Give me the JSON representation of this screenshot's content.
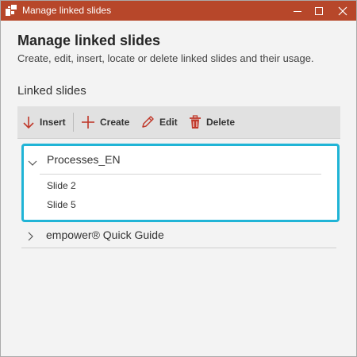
{
  "window": {
    "title": "Manage linked slides",
    "app_icon": "linked-slides-app-icon",
    "titlebar_color": "#b7472a"
  },
  "header": {
    "title": "Manage linked slides",
    "subtitle": "Create, edit, insert, locate or delete linked slides and their usage."
  },
  "section_label": "Linked slides",
  "toolbar": {
    "insert_label": "Insert",
    "create_label": "Create",
    "edit_label": "Edit",
    "delete_label": "Delete",
    "insert_icon": "arrow-down-icon",
    "create_icon": "plus-icon",
    "edit_icon": "pencil-icon",
    "delete_icon": "trash-icon",
    "icon_color": "#c0392b"
  },
  "groups": [
    {
      "name": "Processes_EN",
      "expanded": true,
      "focused": true,
      "focus_color": "#20b4d6",
      "slides": [
        "Slide 2",
        "Slide 5"
      ]
    },
    {
      "name": "empower® Quick Guide",
      "expanded": false
    }
  ]
}
